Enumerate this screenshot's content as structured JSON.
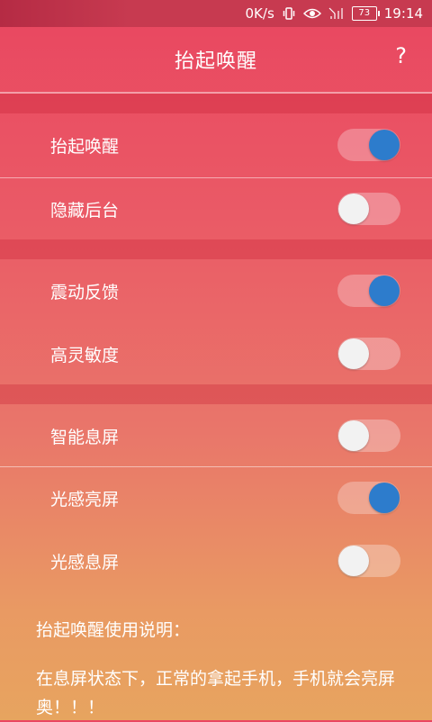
{
  "status_bar": {
    "network_speed": "0K/s",
    "battery_level": "73",
    "time": "19:14",
    "icons": [
      "vibrate-icon",
      "eye-icon",
      "signal-icon"
    ]
  },
  "header": {
    "title": "抬起唤醒",
    "help_label": "?"
  },
  "settings": [
    {
      "label": "抬起唤醒",
      "enabled": true
    },
    {
      "label": "隐藏后台",
      "enabled": false
    },
    {
      "label": "震动反馈",
      "enabled": true
    },
    {
      "label": "高灵敏度",
      "enabled": false
    },
    {
      "label": "智能息屏",
      "enabled": false
    },
    {
      "label": "光感亮屏",
      "enabled": true
    },
    {
      "label": "光感息屏",
      "enabled": false
    }
  ],
  "info": {
    "title": "抬起唤醒使用说明：",
    "body": "在息屏状态下，正常的拿起手机，手机就会亮屏奥！！！"
  },
  "colors": {
    "switch_on_thumb": "#2d7ccc",
    "switch_off_thumb": "#f2f2f2",
    "background_top": "#e94660",
    "background_bottom": "#e7a45f"
  }
}
